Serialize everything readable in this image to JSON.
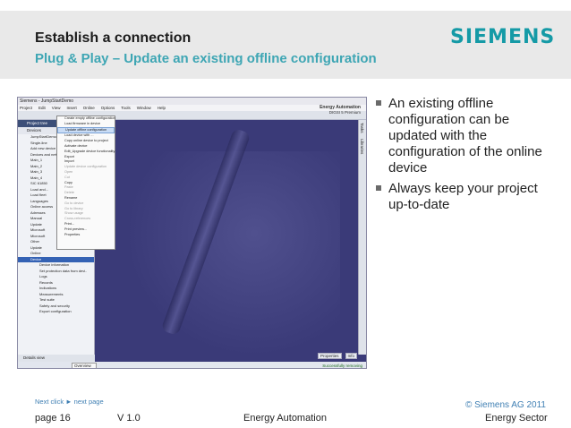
{
  "header": {
    "title": "Establish a connection",
    "subtitle": "Plug & Play – Update an existing offline configuration",
    "logo_text": "SIEMENS",
    "logo_color": "#159aa6",
    "subtitle_color": "#3ea6b4"
  },
  "screenshot": {
    "window_title": "Siemens  -  JumpStartDemo",
    "menu": [
      "Project",
      "Edit",
      "View",
      "Insert",
      "Online",
      "Options",
      "Tools",
      "Window",
      "Help"
    ],
    "brand_line1": "Energy Automation",
    "brand_line2": "DIGSI 5 Premium",
    "tree_header": "Project tree",
    "tree_sub": "Devices",
    "tree_rows": [
      {
        "label": "JumpStartDemo",
        "highlight": false,
        "indent": false
      },
      {
        "label": "Single-line",
        "highlight": false,
        "indent": false
      },
      {
        "label": "Add new device",
        "highlight": false,
        "indent": false
      },
      {
        "label": "Devices and networks",
        "highlight": false,
        "indent": false
      },
      {
        "label": "Main_1",
        "highlight": false,
        "indent": false
      },
      {
        "label": "Main_2",
        "highlight": false,
        "indent": false
      },
      {
        "label": "Main_3",
        "highlight": false,
        "indent": false
      },
      {
        "label": "Main_4",
        "highlight": false,
        "indent": false
      },
      {
        "label": "SIC 61850",
        "highlight": false,
        "indent": false
      },
      {
        "label": "Load and...",
        "highlight": false,
        "indent": false
      },
      {
        "label": "Load fleet",
        "highlight": false,
        "indent": false
      },
      {
        "label": "Languages",
        "highlight": false,
        "indent": false
      },
      {
        "label": "Online access",
        "highlight": false,
        "indent": false
      },
      {
        "label": "Adresses",
        "highlight": false,
        "indent": false
      },
      {
        "label": "Manual",
        "highlight": false,
        "indent": false
      },
      {
        "label": "Update",
        "highlight": false,
        "indent": false
      },
      {
        "label": "Microsoft",
        "highlight": false,
        "indent": false
      },
      {
        "label": "Microsoft",
        "highlight": false,
        "indent": false
      },
      {
        "label": "Other",
        "highlight": false,
        "indent": false
      },
      {
        "label": "Update",
        "highlight": false,
        "indent": false
      },
      {
        "label": "Online",
        "highlight": false,
        "indent": false
      },
      {
        "label": "Device",
        "highlight": true,
        "indent": false
      },
      {
        "label": "Device information",
        "highlight": false,
        "indent": true
      },
      {
        "label": "Set protection data from devi..",
        "highlight": false,
        "indent": true
      },
      {
        "label": "Logs",
        "highlight": false,
        "indent": true
      },
      {
        "label": "Records",
        "highlight": false,
        "indent": true
      },
      {
        "label": "Indications",
        "highlight": false,
        "indent": true
      },
      {
        "label": "Measurements",
        "highlight": false,
        "indent": true
      },
      {
        "label": "Test suite",
        "highlight": false,
        "indent": true
      },
      {
        "label": "Safety and security",
        "highlight": false,
        "indent": true
      },
      {
        "label": "Export configuration",
        "highlight": false,
        "indent": true
      }
    ],
    "context_menu": [
      {
        "label": "Create empty offline configuration",
        "selected": false,
        "dim": false
      },
      {
        "label": "Load firmware in device",
        "selected": false,
        "dim": false
      },
      {
        "label": "Update offline configuration",
        "selected": true,
        "dim": false
      },
      {
        "label": "Load device with ...",
        "selected": false,
        "dim": false
      },
      {
        "label": "Copy online device to project",
        "selected": false,
        "dim": false
      },
      {
        "label": "Activate device",
        "selected": false,
        "dim": false
      },
      {
        "label": "Edit_Upgrade device functionality",
        "selected": false,
        "dim": false
      },
      {
        "label": "Export",
        "selected": false,
        "dim": false
      },
      {
        "label": "Import",
        "selected": false,
        "dim": false
      },
      {
        "label": "Update device configuration",
        "selected": false,
        "dim": true
      },
      {
        "label": "Open",
        "selected": false,
        "dim": true
      },
      {
        "label": "Cut",
        "selected": false,
        "dim": true
      },
      {
        "label": "Copy",
        "selected": false,
        "dim": false
      },
      {
        "label": "Paste",
        "selected": false,
        "dim": true
      },
      {
        "label": "Delete",
        "selected": false,
        "dim": true
      },
      {
        "label": "Rename",
        "selected": false,
        "dim": false
      },
      {
        "label": "Go to device",
        "selected": false,
        "dim": true
      },
      {
        "label": "Go to library",
        "selected": false,
        "dim": true
      },
      {
        "label": "Show usage",
        "selected": false,
        "dim": true
      },
      {
        "label": "Cross-references",
        "selected": false,
        "dim": true
      },
      {
        "label": "Print...",
        "selected": false,
        "dim": false
      },
      {
        "label": "Print preview...",
        "selected": false,
        "dim": false
      },
      {
        "label": "Properties",
        "selected": false,
        "dim": false
      }
    ],
    "vtabs": [
      "Tasks",
      "Libraries"
    ],
    "details_view": "Details view",
    "props_tabs": [
      "Properties",
      "Info"
    ],
    "overview": "Overview",
    "status_ok": "Successfully removing"
  },
  "bullets": [
    "An existing offline configuration can be updated with the configuration of the online device",
    "Always keep your project up-to-date"
  ],
  "footer": {
    "next_click": "Next click ► next page",
    "copyright": "© Siemens AG 2011",
    "page": "page 16",
    "version": "V 1.0",
    "center": "Energy Automation",
    "sector": "Energy Sector"
  }
}
